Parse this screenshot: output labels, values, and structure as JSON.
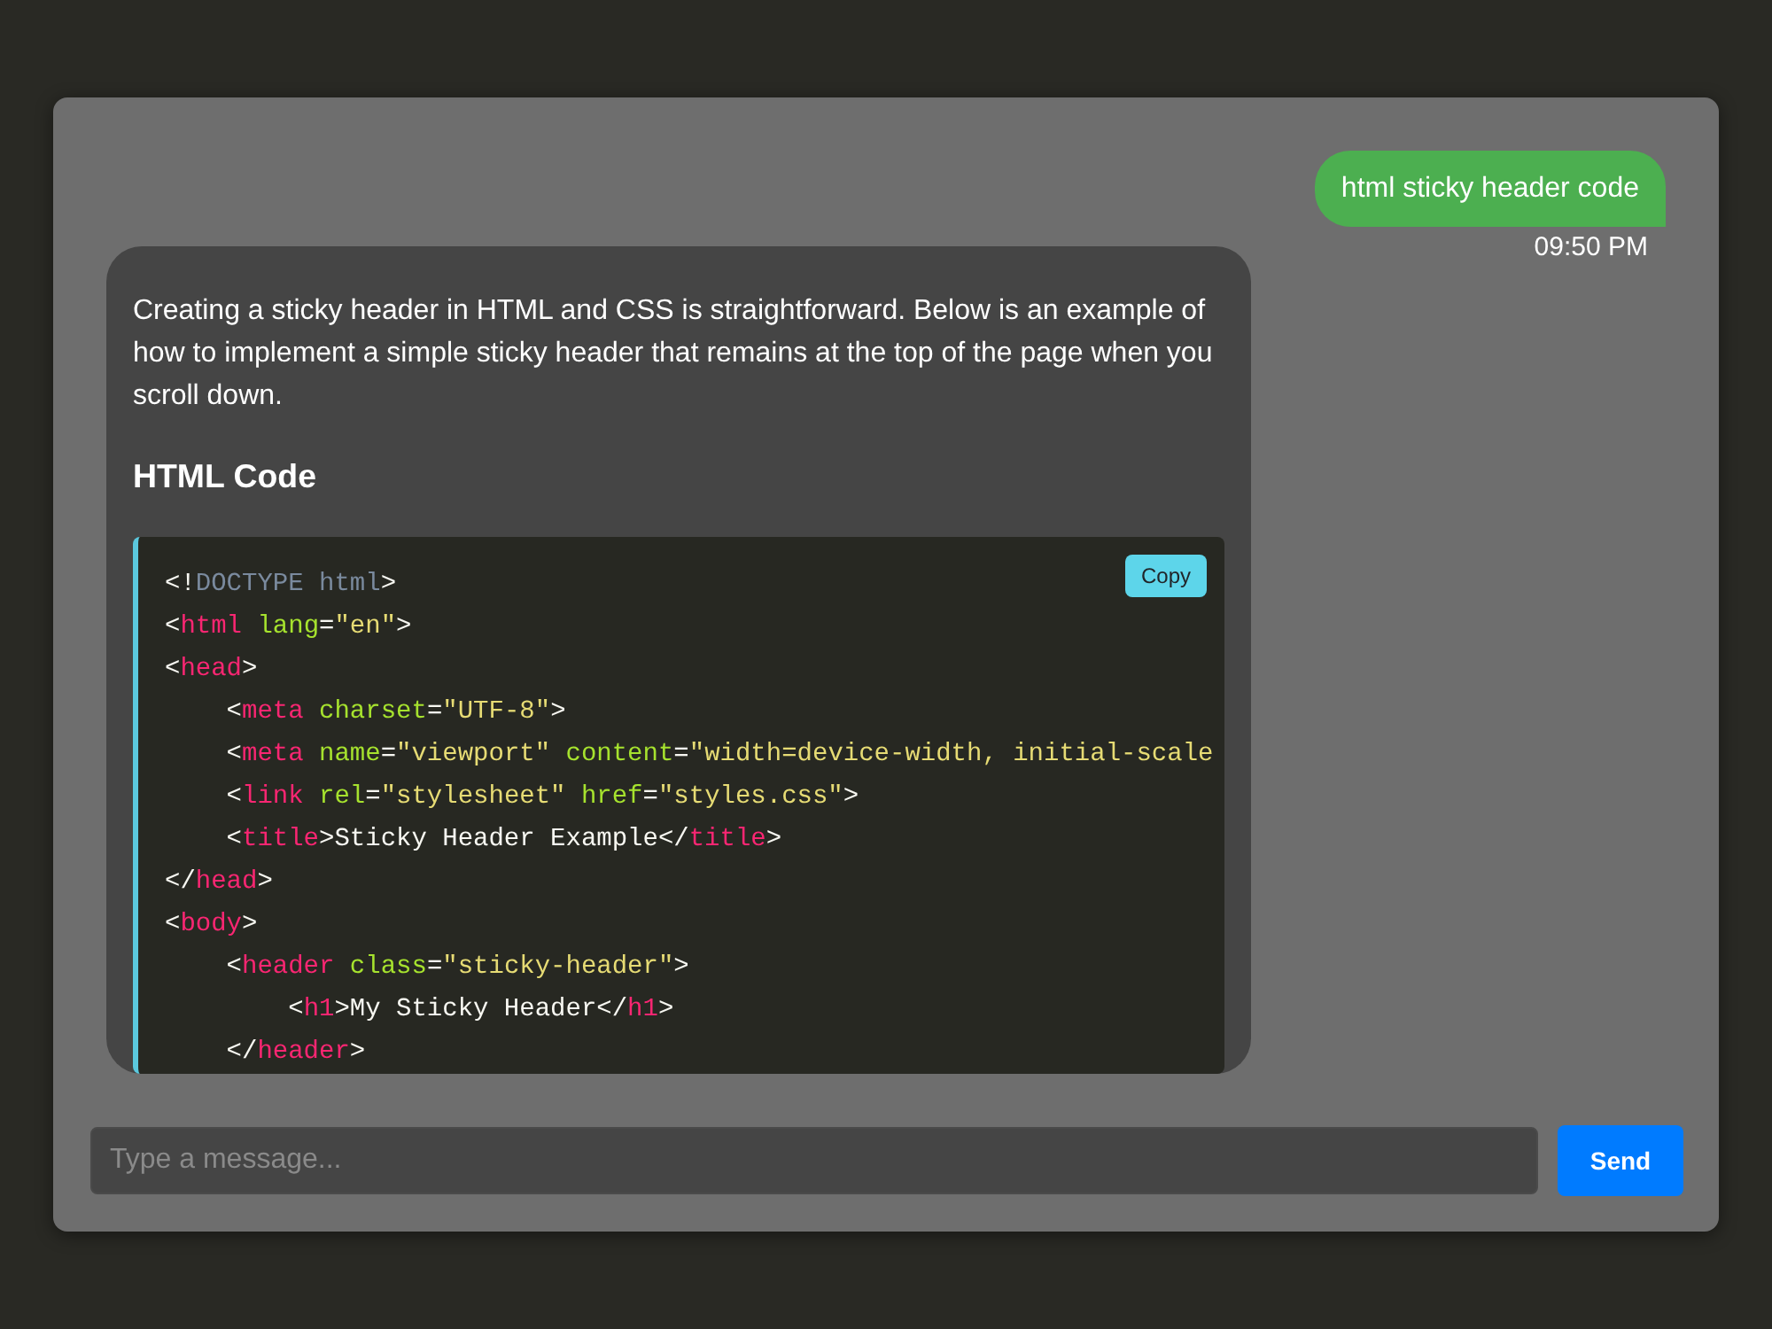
{
  "messages": [
    {
      "kind": "user",
      "text": "html sticky header code",
      "time": "09:50 PM"
    },
    {
      "kind": "bot",
      "blocks": [
        {
          "kind": "paragraph",
          "text": "Creating a sticky header in HTML and CSS is straightforward. Below is an example of how to implement a simple sticky header that remains at the top of the page when you scroll down."
        },
        {
          "kind": "heading",
          "text": "HTML Code"
        },
        {
          "kind": "code",
          "copy_label": "Copy",
          "lines": [
            {
              "tokens": [
                {
                  "kind": "punct",
                  "text": "<!"
                },
                {
                  "kind": "doctype",
                  "text": "DOCTYPE html"
                },
                {
                  "kind": "punct",
                  "text": ">"
                }
              ]
            },
            {
              "tokens": [
                {
                  "kind": "punct",
                  "text": "<"
                },
                {
                  "kind": "tag",
                  "text": "html"
                },
                {
                  "kind": "attr",
                  "text": " lang"
                },
                {
                  "kind": "punct",
                  "text": "="
                },
                {
                  "kind": "string",
                  "text": "\"en\""
                },
                {
                  "kind": "punct",
                  "text": ">"
                }
              ]
            },
            {
              "tokens": [
                {
                  "kind": "punct",
                  "text": "<"
                },
                {
                  "kind": "tag",
                  "text": "head"
                },
                {
                  "kind": "punct",
                  "text": ">"
                }
              ],
              "children": [
                {
                  "tokens": [
                    {
                      "kind": "punct",
                      "text": "<"
                    },
                    {
                      "kind": "tag",
                      "text": "meta"
                    },
                    {
                      "kind": "attr",
                      "text": " charset"
                    },
                    {
                      "kind": "punct",
                      "text": "="
                    },
                    {
                      "kind": "string",
                      "text": "\"UTF-8\""
                    },
                    {
                      "kind": "punct",
                      "text": ">"
                    }
                  ]
                },
                {
                  "tokens": [
                    {
                      "kind": "punct",
                      "text": "<"
                    },
                    {
                      "kind": "tag",
                      "text": "meta"
                    },
                    {
                      "kind": "attr",
                      "text": " name"
                    },
                    {
                      "kind": "punct",
                      "text": "="
                    },
                    {
                      "kind": "string",
                      "text": "\"viewport\""
                    },
                    {
                      "kind": "attr",
                      "text": " content"
                    },
                    {
                      "kind": "punct",
                      "text": "="
                    },
                    {
                      "kind": "string",
                      "text": "\"width=device-width, initial-scale"
                    }
                  ]
                },
                {
                  "tokens": [
                    {
                      "kind": "punct",
                      "text": "<"
                    },
                    {
                      "kind": "tag",
                      "text": "link"
                    },
                    {
                      "kind": "attr",
                      "text": " rel"
                    },
                    {
                      "kind": "punct",
                      "text": "="
                    },
                    {
                      "kind": "string",
                      "text": "\"stylesheet\""
                    },
                    {
                      "kind": "attr",
                      "text": " href"
                    },
                    {
                      "kind": "punct",
                      "text": "="
                    },
                    {
                      "kind": "string",
                      "text": "\"styles.css\""
                    },
                    {
                      "kind": "punct",
                      "text": ">"
                    }
                  ]
                },
                {
                  "tokens": [
                    {
                      "kind": "punct",
                      "text": "<"
                    },
                    {
                      "kind": "tag",
                      "text": "title"
                    },
                    {
                      "kind": "text",
                      "text": ">Sticky Header Example</"
                    },
                    {
                      "kind": "tag",
                      "text": "title"
                    },
                    {
                      "kind": "punct",
                      "text": ">"
                    }
                  ]
                }
              ]
            },
            {
              "tokens": [
                {
                  "kind": "punct",
                  "text": "</"
                },
                {
                  "kind": "tag",
                  "text": "head"
                },
                {
                  "kind": "punct",
                  "text": ">"
                }
              ]
            },
            {
              "tokens": [
                {
                  "kind": "punct",
                  "text": "<"
                },
                {
                  "kind": "tag",
                  "text": "body"
                },
                {
                  "kind": "punct",
                  "text": ">"
                }
              ],
              "children": [
                {
                  "tokens": [
                    {
                      "kind": "punct",
                      "text": "<"
                    },
                    {
                      "kind": "tag",
                      "text": "header"
                    },
                    {
                      "kind": "attr",
                      "text": " class"
                    },
                    {
                      "kind": "punct",
                      "text": "="
                    },
                    {
                      "kind": "string",
                      "text": "\"sticky-header\""
                    },
                    {
                      "kind": "punct",
                      "text": ">"
                    }
                  ],
                  "children": [
                    {
                      "tokens": [
                        {
                          "kind": "punct",
                          "text": "<"
                        },
                        {
                          "kind": "tag",
                          "text": "h1"
                        },
                        {
                          "kind": "text",
                          "text": ">My Sticky Header</"
                        },
                        {
                          "kind": "tag",
                          "text": "h1"
                        },
                        {
                          "kind": "punct",
                          "text": ">"
                        }
                      ]
                    }
                  ]
                },
                {
                  "tokens": [
                    {
                      "kind": "punct",
                      "text": "</"
                    },
                    {
                      "kind": "tag",
                      "text": "header"
                    },
                    {
                      "kind": "punct",
                      "text": ">"
                    }
                  ]
                }
              ]
            }
          ]
        }
      ]
    }
  ],
  "composer": {
    "placeholder": "Type a message...",
    "send_label": "Send"
  }
}
